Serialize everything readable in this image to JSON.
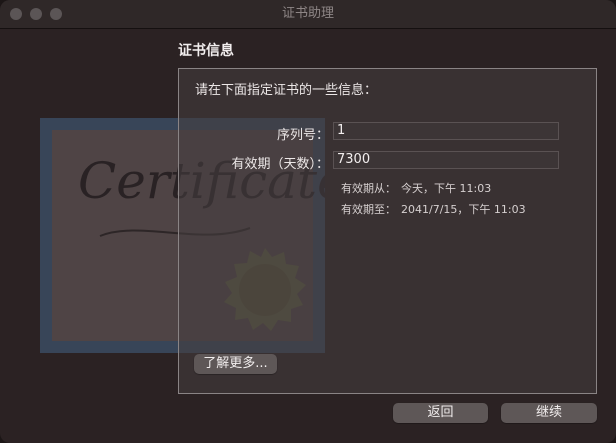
{
  "window": {
    "title": "证书助理"
  },
  "section": {
    "heading": "证书信息"
  },
  "panel": {
    "prompt": "请在下面指定证书的一些信息：",
    "serial": {
      "label": "序列号：",
      "value": "1"
    },
    "validity": {
      "label": "有效期（天数）：",
      "value": "7300"
    },
    "valid_from": {
      "label": "有效期从：",
      "value": "今天，下午 11:03"
    },
    "valid_to": {
      "label": "有效期至：",
      "value": "2041/7/15，下午 11:03"
    },
    "learn_more_label": "了解更多..."
  },
  "artwork": {
    "text": "Certificate"
  },
  "footer": {
    "back_label": "返回",
    "continue_label": "继续"
  }
}
